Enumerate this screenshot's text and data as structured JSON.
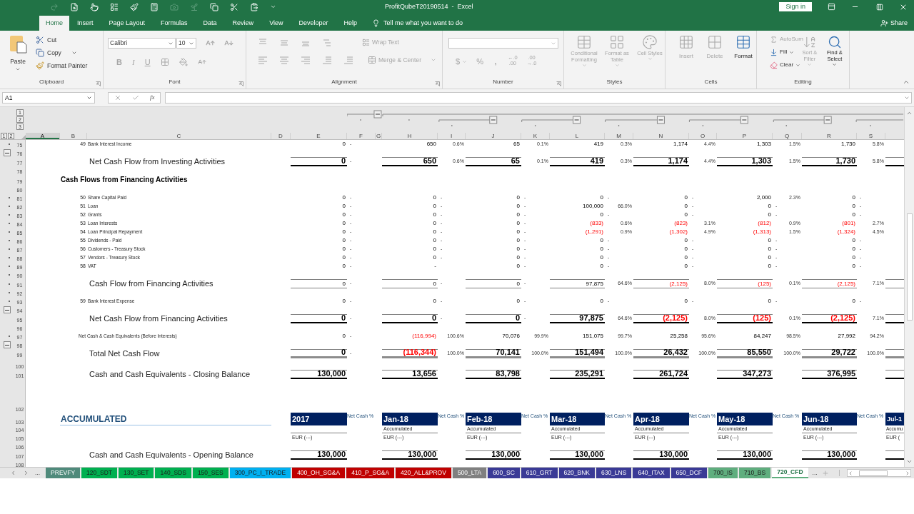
{
  "title_bar": {
    "title": "ProfitQubeT20190514  -  Excel",
    "sign_in": "Sign in"
  },
  "menu_tabs": [
    {
      "label": "Home",
      "selected": true
    },
    {
      "label": "Insert",
      "selected": false
    },
    {
      "label": "Page Layout",
      "selected": false
    },
    {
      "label": "Formulas",
      "selected": false
    },
    {
      "label": "Data",
      "selected": false
    },
    {
      "label": "Review",
      "selected": false
    },
    {
      "label": "View",
      "selected": false
    },
    {
      "label": "Developer",
      "selected": false
    },
    {
      "label": "Help",
      "selected": false
    }
  ],
  "tell_me": "Tell me what you want to do",
  "share": "Share",
  "ribbon": {
    "clipboard": {
      "label": "Clipboard",
      "paste": "Paste",
      "cut": "Cut",
      "copy": "Copy",
      "format_painter": "Format Painter"
    },
    "font": {
      "label": "Font",
      "family": "Calibri",
      "size": "10",
      "bold": "B",
      "italic": "I",
      "underline": "U",
      "disabled": true
    },
    "alignment": {
      "label": "Alignment",
      "wrap_text": "Wrap Text",
      "merge_center": "Merge & Center",
      "disabled": true
    },
    "number": {
      "label": "Number",
      "currency": "$",
      "percent": "%",
      "comma": ",",
      "increase_decimal": [
        "←.0",
        ".00"
      ],
      "decrease_decimal": [
        ".00",
        "→.0"
      ],
      "disabled": true
    },
    "styles": {
      "label": "Styles",
      "buttons": [
        {
          "label": "Conditional Formatting",
          "disabled": true
        },
        {
          "label": "Format as Table",
          "disabled": true
        },
        {
          "label": "Cell Styles",
          "disabled": true
        }
      ]
    },
    "cells": {
      "label": "Cells",
      "buttons": [
        {
          "label": "Insert",
          "disabled": true
        },
        {
          "label": "Delete",
          "disabled": true
        },
        {
          "label": "Format",
          "disabled": false
        }
      ]
    },
    "editing": {
      "label": "Editing",
      "autosum": {
        "label": "AutoSum",
        "disabled": true
      },
      "fill": {
        "label": "Fill",
        "disabled": false
      },
      "clear": {
        "label": "Clear",
        "disabled": false
      },
      "sort_filter": {
        "label": "Sort & Filter",
        "disabled": true
      },
      "find_select": {
        "label": "Find & Select",
        "disabled": false
      }
    }
  },
  "formula_bar": {
    "name_box": "A1",
    "function": "fx"
  },
  "outline": {
    "column_levels": [
      "1",
      "2",
      "3"
    ],
    "row_levels": [
      "1",
      "2"
    ]
  },
  "columns": [
    {
      "label": "A",
      "selected": true
    },
    {
      "label": "B",
      "selected": false
    },
    {
      "label": "C",
      "selected": false
    },
    {
      "label": "D",
      "selected": false
    },
    {
      "label": "E",
      "selected": false
    },
    {
      "label": "F",
      "selected": false
    },
    {
      "label": "G",
      "selected": false
    },
    {
      "label": "H",
      "selected": false
    },
    {
      "label": "I",
      "selected": false
    },
    {
      "label": "J",
      "selected": false
    },
    {
      "label": "K",
      "selected": false
    },
    {
      "label": "L",
      "selected": false
    },
    {
      "label": "M",
      "selected": false
    },
    {
      "label": "N",
      "selected": false
    },
    {
      "label": "O",
      "selected": false
    },
    {
      "label": "P",
      "selected": false
    },
    {
      "label": "Q",
      "selected": false
    },
    {
      "label": "R",
      "selected": false
    },
    {
      "label": "S",
      "selected": false
    }
  ],
  "rows": [
    {
      "number": "75",
      "kind": "item",
      "grouped": true,
      "collapse": false,
      "index": "49",
      "label": "Bank Interest Income",
      "cells": [
        {
          "value": "0",
          "dash": "-",
          "negative": false
        },
        {
          "value": "650",
          "share": "0.6%",
          "negative": false
        },
        {
          "value": "65",
          "share": "0.1%",
          "negative": false
        },
        {
          "value": "419",
          "share": "0.3%",
          "negative": false
        },
        {
          "value": "1,174",
          "share": "4.4%",
          "negative": false
        },
        {
          "value": "1,303",
          "share": "1.5%",
          "negative": false
        },
        {
          "value": "1,730",
          "share": "5.8%",
          "negative": false
        }
      ]
    },
    {
      "number": "76",
      "kind": "spacer",
      "grouped": false,
      "collapse": true
    },
    {
      "number": "77",
      "kind": "total",
      "grouped": false,
      "collapse": false,
      "label": "Net Cash Flow from Investing Activities",
      "cells": [
        {
          "value": "0",
          "dash": "-",
          "negative": false
        },
        {
          "value": "650",
          "share": "0.6%",
          "negative": false
        },
        {
          "value": "65",
          "share": "0.1%",
          "negative": false
        },
        {
          "value": "419",
          "share": "0.3%",
          "negative": false
        },
        {
          "value": "1,174",
          "share": "4.4%",
          "negative": false
        },
        {
          "value": "1,303",
          "share": "1.5%",
          "negative": false
        },
        {
          "value": "1,730",
          "share": "5.8%",
          "negative": false
        }
      ]
    },
    {
      "number": "78",
      "kind": "spacer",
      "grouped": false,
      "collapse": false
    },
    {
      "number": "79",
      "kind": "heading",
      "grouped": false,
      "collapse": false,
      "label": "Cash Flows from Financing Activities"
    },
    {
      "number": "80",
      "kind": "spacer",
      "grouped": false,
      "collapse": false
    },
    {
      "number": "81",
      "kind": "item",
      "grouped": true,
      "collapse": false,
      "index": "50",
      "label": "Share Capital Paid",
      "cells": [
        {
          "value": "0",
          "dash": "-",
          "negative": false
        },
        {
          "value": "0",
          "dash": "-",
          "negative": false
        },
        {
          "value": "0",
          "dash": "-",
          "negative": false
        },
        {
          "value": "0",
          "dash": "-",
          "negative": false
        },
        {
          "value": "0",
          "dash": "-",
          "negative": false
        },
        {
          "value": "2,000",
          "share": "2.3%",
          "negative": false
        },
        {
          "value": "0",
          "dash": "-",
          "negative": false
        }
      ]
    },
    {
      "number": "82",
      "kind": "item",
      "grouped": true,
      "collapse": false,
      "index": "51",
      "label": "Loan",
      "cells": [
        {
          "value": "0",
          "dash": "-",
          "negative": false
        },
        {
          "value": "0",
          "dash": "-",
          "negative": false
        },
        {
          "value": "0",
          "dash": "-",
          "negative": false
        },
        {
          "value": "100,000",
          "share": "66.0%",
          "negative": false
        },
        {
          "value": "0",
          "dash": "-",
          "negative": false
        },
        {
          "value": "0",
          "dash": "-",
          "negative": false
        },
        {
          "value": "0",
          "dash": "-",
          "negative": false
        }
      ]
    },
    {
      "number": "83",
      "kind": "item",
      "grouped": true,
      "collapse": false,
      "index": "52",
      "label": "Grants",
      "cells": [
        {
          "value": "0",
          "dash": "-",
          "negative": false
        },
        {
          "value": "0",
          "dash": "-",
          "negative": false
        },
        {
          "value": "0",
          "dash": "-",
          "negative": false
        },
        {
          "value": "0",
          "dash": "-",
          "negative": false
        },
        {
          "value": "0",
          "dash": "-",
          "negative": false
        },
        {
          "value": "0",
          "dash": "-",
          "negative": false
        },
        {
          "value": "0",
          "dash": "-",
          "negative": false
        }
      ]
    },
    {
      "number": "84",
      "kind": "item",
      "grouped": true,
      "collapse": false,
      "index": "53",
      "label": "Loan Interests",
      "cells": [
        {
          "value": "0",
          "dash": "-",
          "negative": false
        },
        {
          "value": "0",
          "dash": "-",
          "negative": false
        },
        {
          "value": "0",
          "dash": "-",
          "negative": false
        },
        {
          "value": "(833)",
          "share": "0.6%",
          "negative": true
        },
        {
          "value": "(823)",
          "share": "3.1%",
          "negative": true
        },
        {
          "value": "(812)",
          "share": "0.9%",
          "negative": true
        },
        {
          "value": "(801)",
          "share": "2.7%",
          "negative": true
        }
      ]
    },
    {
      "number": "85",
      "kind": "item",
      "grouped": true,
      "collapse": false,
      "index": "54",
      "label": "Loan Principal Repayment",
      "cells": [
        {
          "value": "0",
          "dash": "-",
          "negative": false
        },
        {
          "value": "0",
          "dash": "-",
          "negative": false
        },
        {
          "value": "0",
          "dash": "-",
          "negative": false
        },
        {
          "value": "(1,291)",
          "share": "0.9%",
          "negative": true
        },
        {
          "value": "(1,302)",
          "share": "4.9%",
          "negative": true
        },
        {
          "value": "(1,313)",
          "share": "1.5%",
          "negative": true
        },
        {
          "value": "(1,324)",
          "share": "4.5%",
          "negative": true
        }
      ]
    },
    {
      "number": "86",
      "kind": "item",
      "grouped": true,
      "collapse": false,
      "index": "55",
      "label": "Dividends - Paid",
      "cells": [
        {
          "value": "0",
          "dash": "-",
          "negative": false
        },
        {
          "value": "0",
          "dash": "-",
          "negative": false
        },
        {
          "value": "0",
          "dash": "-",
          "negative": false
        },
        {
          "value": "0",
          "dash": "-",
          "negative": false
        },
        {
          "value": "0",
          "dash": "-",
          "negative": false
        },
        {
          "value": "0",
          "dash": "-",
          "negative": false
        },
        {
          "value": "0",
          "dash": "-",
          "negative": false
        }
      ]
    },
    {
      "number": "87",
      "kind": "item",
      "grouped": true,
      "collapse": false,
      "index": "56",
      "label": "Customers - Treasury Stock",
      "cells": [
        {
          "value": "0",
          "dash": "-",
          "negative": false
        },
        {
          "value": "0",
          "dash": "-",
          "negative": false
        },
        {
          "value": "0",
          "dash": "-",
          "negative": false
        },
        {
          "value": "0",
          "dash": "-",
          "negative": false
        },
        {
          "value": "0",
          "dash": "-",
          "negative": false
        },
        {
          "value": "0",
          "dash": "-",
          "negative": false
        },
        {
          "value": "0",
          "dash": "-",
          "negative": false
        }
      ]
    },
    {
      "number": "88",
      "kind": "item",
      "grouped": true,
      "collapse": false,
      "index": "57",
      "label": "Vendors - Treasury Stock",
      "cells": [
        {
          "value": "0",
          "dash": "-",
          "negative": false
        },
        {
          "value": "0",
          "dash": "-",
          "negative": false
        },
        {
          "value": "0",
          "dash": "-",
          "negative": false
        },
        {
          "value": "0",
          "dash": "-",
          "negative": false
        },
        {
          "value": "0",
          "dash": "-",
          "negative": false
        },
        {
          "value": "0",
          "dash": "-",
          "negative": false
        },
        {
          "value": "0",
          "dash": "-",
          "negative": false
        }
      ]
    },
    {
      "number": "89",
      "kind": "item",
      "grouped": true,
      "collapse": false,
      "index": "58",
      "label": "VAT",
      "cells": [
        {
          "value": "0",
          "dash": "-",
          "negative": false
        },
        {
          "value": "-",
          "negative": false
        },
        {
          "value": "0",
          "dash": "-",
          "negative": false
        },
        {
          "value": "0",
          "dash": "-",
          "negative": false
        },
        {
          "value": "0",
          "dash": "-",
          "negative": false
        },
        {
          "value": "0",
          "dash": "-",
          "negative": false
        },
        {
          "value": "0",
          "dash": "-",
          "negative": false
        }
      ]
    },
    {
      "number": "90",
      "kind": "spacer",
      "grouped": true,
      "collapse": false
    },
    {
      "number": "91",
      "kind": "subtotal",
      "grouped": true,
      "collapse": false,
      "label": "Cash Flow from Financing Activities",
      "cells": [
        {
          "value": "0",
          "dash": "-",
          "negative": false
        },
        {
          "value": "0",
          "dash": "-",
          "negative": false
        },
        {
          "value": "0",
          "dash": "-",
          "negative": false
        },
        {
          "value": "97,875",
          "share": "64.6%",
          "negative": false
        },
        {
          "value": "(2,125)",
          "share": "8.0%",
          "negative": true
        },
        {
          "value": "(125)",
          "share": "0.1%",
          "negative": true
        },
        {
          "value": "(2,125)",
          "share": "7.1%",
          "negative": true
        }
      ]
    },
    {
      "number": "92",
      "kind": "spacer",
      "grouped": true,
      "collapse": false
    },
    {
      "number": "93",
      "kind": "item",
      "grouped": true,
      "collapse": false,
      "index": "59",
      "label": "Bank Interest Expense",
      "cells": [
        {
          "value": "0",
          "dash": "-",
          "negative": false
        },
        {
          "value": "0",
          "dash": "-",
          "negative": false
        },
        {
          "value": "0",
          "dash": "-",
          "negative": false
        },
        {
          "value": "0",
          "dash": "-",
          "negative": false
        },
        {
          "value": "0",
          "dash": "-",
          "negative": false
        },
        {
          "value": "0",
          "dash": "-",
          "negative": false
        },
        {
          "value": "0",
          "dash": "-",
          "negative": false
        }
      ]
    },
    {
      "number": "94",
      "kind": "spacer",
      "grouped": false,
      "collapse": true
    },
    {
      "number": "95",
      "kind": "total",
      "grouped": false,
      "collapse": false,
      "label": "Net Cash Flow from Financing Activities",
      "cells": [
        {
          "value": "0",
          "dash": "-",
          "negative": false
        },
        {
          "value": "0",
          "dash": "-",
          "negative": false
        },
        {
          "value": "0",
          "dash": "-",
          "negative": false
        },
        {
          "value": "97,875",
          "share": "64.6%",
          "negative": false
        },
        {
          "value": "(2,125)",
          "share": "8.0%",
          "negative": true
        },
        {
          "value": "(125)",
          "share": "0.1%",
          "negative": true
        },
        {
          "value": "(2,125)",
          "share": "7.1%",
          "negative": true
        }
      ]
    },
    {
      "number": "96",
      "kind": "spacer",
      "grouped": false,
      "collapse": false
    },
    {
      "number": "97",
      "kind": "note",
      "grouped": true,
      "collapse": false,
      "label": "Net Cash & Cash Equivalents (Before Interests)",
      "cells": [
        {
          "value": "0",
          "dash": "-",
          "negative": false
        },
        {
          "value": "(116,994)",
          "share": "100.6%",
          "negative": true
        },
        {
          "value": "70,076",
          "share": "99.9%",
          "negative": false
        },
        {
          "value": "151,075",
          "share": "99.7%",
          "negative": false
        },
        {
          "value": "25,258",
          "share": "95.6%",
          "negative": false
        },
        {
          "value": "84,247",
          "share": "98.5%",
          "negative": false
        },
        {
          "value": "27,992",
          "share": "94.2%",
          "negative": false
        }
      ]
    },
    {
      "number": "98",
      "kind": "spacer",
      "grouped": false,
      "collapse": true
    },
    {
      "number": "99",
      "kind": "grand_total",
      "grouped": false,
      "collapse": false,
      "label": "Total Net Cash Flow",
      "cells": [
        {
          "value": "0",
          "dash": "-",
          "negative": false
        },
        {
          "value": "(116,344)",
          "share": "100.0%",
          "negative": true
        },
        {
          "value": "70,141",
          "share": "100.0%",
          "negative": false
        },
        {
          "value": "151,494",
          "share": "100.0%",
          "negative": false
        },
        {
          "value": "26,432",
          "share": "100.0%",
          "negative": false
        },
        {
          "value": "85,550",
          "share": "100.0%",
          "negative": false
        },
        {
          "value": "29,722",
          "share": "100.0%",
          "negative": false
        }
      ]
    },
    {
      "number": "100",
      "kind": "gap",
      "grouped": false,
      "collapse": false
    },
    {
      "number": "101",
      "kind": "total",
      "grouped": false,
      "collapse": false,
      "label": "Cash and Cash Equivalents - Closing Balance",
      "cells": [
        {
          "value": "130,000",
          "negative": false
        },
        {
          "value": "13,656",
          "negative": false
        },
        {
          "value": "83,798",
          "negative": false
        },
        {
          "value": "235,291",
          "negative": false
        },
        {
          "value": "261,724",
          "negative": false
        },
        {
          "value": "347,273",
          "negative": false
        },
        {
          "value": "376,995",
          "negative": false
        }
      ]
    }
  ],
  "accumulated": {
    "title": "ACCUMULATED",
    "row_numbers": [
      "102",
      "103",
      "104",
      "105",
      "106"
    ],
    "periods": [
      {
        "label": "2017",
        "share_label": "Net Cash %",
        "unit": "EUR (---)"
      },
      {
        "label": "Jan-18",
        "share_label": "Net Cash %",
        "subtitle": "Accumulated",
        "unit": "EUR (---)"
      },
      {
        "label": "Feb-18",
        "share_label": "Net Cash %",
        "subtitle": "Accumulated",
        "unit": "EUR (---)"
      },
      {
        "label": "Mar-18",
        "share_label": "Net Cash %",
        "subtitle": "Accumulated",
        "unit": "EUR (---)"
      },
      {
        "label": "Apr-18",
        "share_label": "Net Cash %",
        "subtitle": "Accumulated",
        "unit": "EUR (---)"
      },
      {
        "label": "May-18",
        "share_label": "Net Cash %",
        "subtitle": "Accumulated",
        "unit": "EUR (---)"
      },
      {
        "label": "Jun-18",
        "share_label": "Net Cash %",
        "subtitle": "Accumulated",
        "unit": "EUR (---)"
      }
    ],
    "partial_period": {
      "label": "Jul-1",
      "subtitle": "Accumu",
      "unit": "EUR ("
    }
  },
  "closing_rows": [
    {
      "number": "107",
      "kind": "total",
      "grouped": false,
      "collapse": false,
      "label": "Cash and Cash Equivalents - Opening Balance",
      "cells": [
        {
          "value": "130,000",
          "negative": false
        },
        {
          "value": "130,000",
          "negative": false
        },
        {
          "value": "130,000",
          "negative": false
        },
        {
          "value": "130,000",
          "negative": false
        },
        {
          "value": "130,000",
          "negative": false
        },
        {
          "value": "130,000",
          "negative": false
        },
        {
          "value": "130,000",
          "negative": false
        }
      ]
    },
    {
      "number": "108",
      "kind": "spacer",
      "grouped": false,
      "collapse": false
    }
  ],
  "sheet_tabs": [
    {
      "label": "PREVFY",
      "color": "#4f8a7b",
      "selected": false
    },
    {
      "label": "120_SDT",
      "color": "#00b050",
      "selected": false
    },
    {
      "label": "130_SET",
      "color": "#00b050",
      "selected": false
    },
    {
      "label": "140_SDS",
      "color": "#00b050",
      "selected": false
    },
    {
      "label": "150_SES",
      "color": "#00b050",
      "selected": false
    },
    {
      "label": "300_PC_I_TRADE",
      "color": "#00b0f0",
      "selected": false
    },
    {
      "label": "400_OH_SG&A",
      "color": "#c00000",
      "selected": false
    },
    {
      "label": "410_P_SG&A",
      "color": "#c00000",
      "selected": false
    },
    {
      "label": "420_ALL&PROV",
      "color": "#c00000",
      "selected": false
    },
    {
      "label": "500_LTA",
      "color": "#808080",
      "selected": false
    },
    {
      "label": "600_SC",
      "color": "#3a3a96",
      "selected": false
    },
    {
      "label": "610_GRT",
      "color": "#3a3a96",
      "selected": false
    },
    {
      "label": "620_BNK",
      "color": "#3a3a96",
      "selected": false
    },
    {
      "label": "630_LNS",
      "color": "#3a3a96",
      "selected": false
    },
    {
      "label": "640_ITAX",
      "color": "#3a3a96",
      "selected": false
    },
    {
      "label": "650_DCF",
      "color": "#3a3a96",
      "selected": false
    },
    {
      "label": "700_IS",
      "color": "#5fae7e",
      "selected": false
    },
    {
      "label": "710_BS",
      "color": "#5fae7e",
      "selected": false
    },
    {
      "label": "720_CFD",
      "color": "#5fae7e",
      "selected": true
    }
  ],
  "tab_overflow": [
    "...",
    "..."
  ]
}
